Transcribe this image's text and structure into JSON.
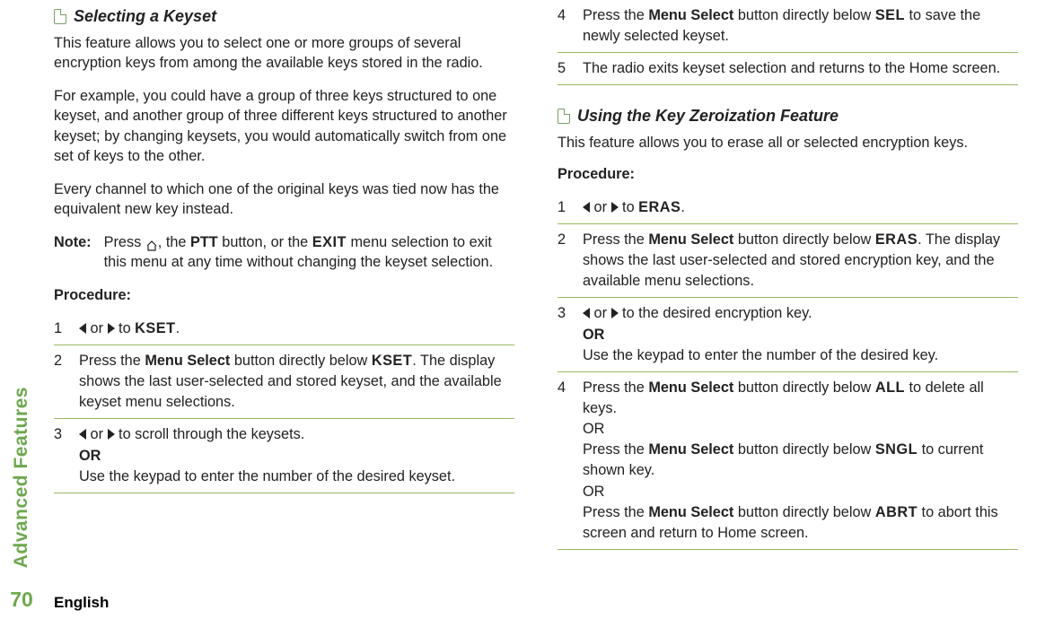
{
  "side": {
    "section_label": "Advanced Features",
    "page_number": "70",
    "language": "English"
  },
  "col1": {
    "heading1": "Selecting a Keyset",
    "p1": "This feature allows you to select one or more groups of several encryption keys from among the available keys stored in the radio.",
    "p2": "For example, you could have a group of three keys structured to one keyset, and another group of three different keys structured to another keyset; by changing keysets, you would automatically switch from one set of keys to the other.",
    "p3": "Every channel to which one of the original keys was tied now has the equivalent new key instead.",
    "note_label": "Note:",
    "note_pre": "Press ",
    "note_mid": ", the ",
    "note_btn": "PTT",
    "note_mid2": " button, or the ",
    "note_menu": "EXIT",
    "note_post": " menu selection to exit this menu at any time without changing the keyset selection.",
    "procedure_label": "Procedure:",
    "steps": [
      {
        "num": "1",
        "pre": "",
        "to": " to ",
        "menu": "KSET",
        "post": "."
      },
      {
        "num": "2",
        "pretext": "Press the ",
        "bold1": "Menu Select",
        "mid": " button directly below ",
        "menu": "KSET",
        "post": ". The display shows the last user-selected and stored keyset, and the available keyset menu selections."
      },
      {
        "num": "3",
        "to": " to scroll through the keysets.",
        "or": "OR",
        "line2": "Use the keypad to enter the number of the desired keyset."
      }
    ]
  },
  "col2": {
    "steps_cont": [
      {
        "num": "4",
        "pretext": "Press the ",
        "bold1": "Menu Select",
        "mid": " button directly below ",
        "menu": "SEL",
        "post": " to save the newly selected keyset."
      },
      {
        "num": "5",
        "text": "The radio exits keyset selection and returns to the Home screen."
      }
    ],
    "heading2": "Using the Key Zeroization Feature",
    "p1": "This feature allows you to erase all or selected encryption keys.",
    "procedure_label": "Procedure:",
    "steps": [
      {
        "num": "1",
        "or_word": " or ",
        "to": " to ",
        "menu": "ERAS",
        "post": "."
      },
      {
        "num": "2",
        "pretext": "Press the ",
        "bold1": "Menu Select",
        "mid": " button directly below ",
        "menu": "ERAS",
        "post": ". The display shows the last user-selected and stored encryption key, and the available menu selections."
      },
      {
        "num": "3",
        "or_word": " or ",
        "to": " to the desired encryption key.",
        "or": "OR",
        "line2": "Use the keypad to enter the number of the desired key."
      },
      {
        "num": "4",
        "pretext": "Press the ",
        "bold1": "Menu Select",
        "mid": " button directly below ",
        "menu1": "ALL",
        "post1": " to delete all keys.",
        "or1": "OR",
        "pretext2": "Press the ",
        "bold2": "Menu Select",
        "mid2": " button directly below ",
        "menu2": "SNGL",
        "post2": " to current shown key.",
        "or2": "OR",
        "pretext3": "Press the ",
        "bold3": "Menu Select",
        "mid3": " button directly below ",
        "menu3": "ABRT",
        "post3": " to abort this screen and return to Home screen."
      }
    ]
  }
}
